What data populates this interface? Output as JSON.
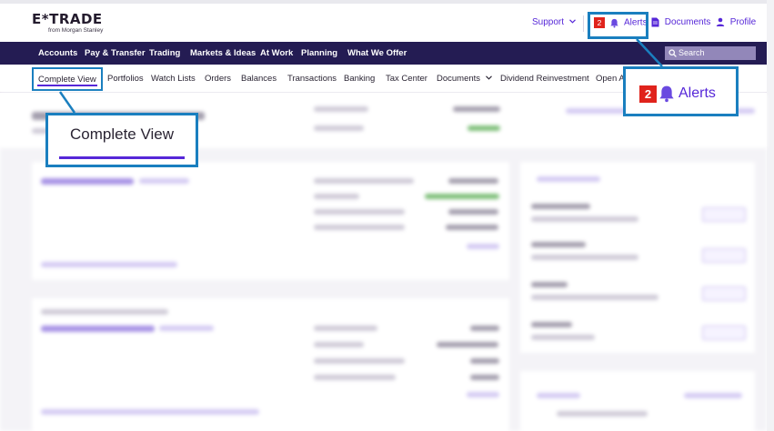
{
  "header": {
    "logo_text": "E*TRADE",
    "logo_subtext": "from Morgan Stanley",
    "support_label": "Support",
    "alerts_count": "2",
    "alerts_label": "Alerts",
    "documents_label": "Documents",
    "profile_label": "Profile"
  },
  "main_nav": {
    "items": [
      "Accounts",
      "Pay & Transfer",
      "Trading",
      "Markets & Ideas",
      "At Work",
      "Planning",
      "What We Offer"
    ],
    "search_placeholder": "Search"
  },
  "sub_nav": {
    "items": [
      "Complete View",
      "Portfolios",
      "Watch Lists",
      "Orders",
      "Balances",
      "Transactions",
      "Banking",
      "Tax Center",
      "Documents",
      "Dividend Reinvestment",
      "Open A"
    ],
    "active": "Complete View"
  },
  "callouts": {
    "view_label": "Complete View",
    "alerts_count": "2",
    "alerts_label": "Alerts"
  },
  "colors": {
    "brand_purple": "#5627d8",
    "nav_background": "#241c53",
    "callout_border": "#1a7fbf",
    "alert_badge": "#e0231c"
  },
  "icons": {
    "support": "chevron-down-icon",
    "alerts": "bell-icon",
    "documents": "document-icon",
    "profile": "person-icon",
    "search": "search-icon"
  }
}
